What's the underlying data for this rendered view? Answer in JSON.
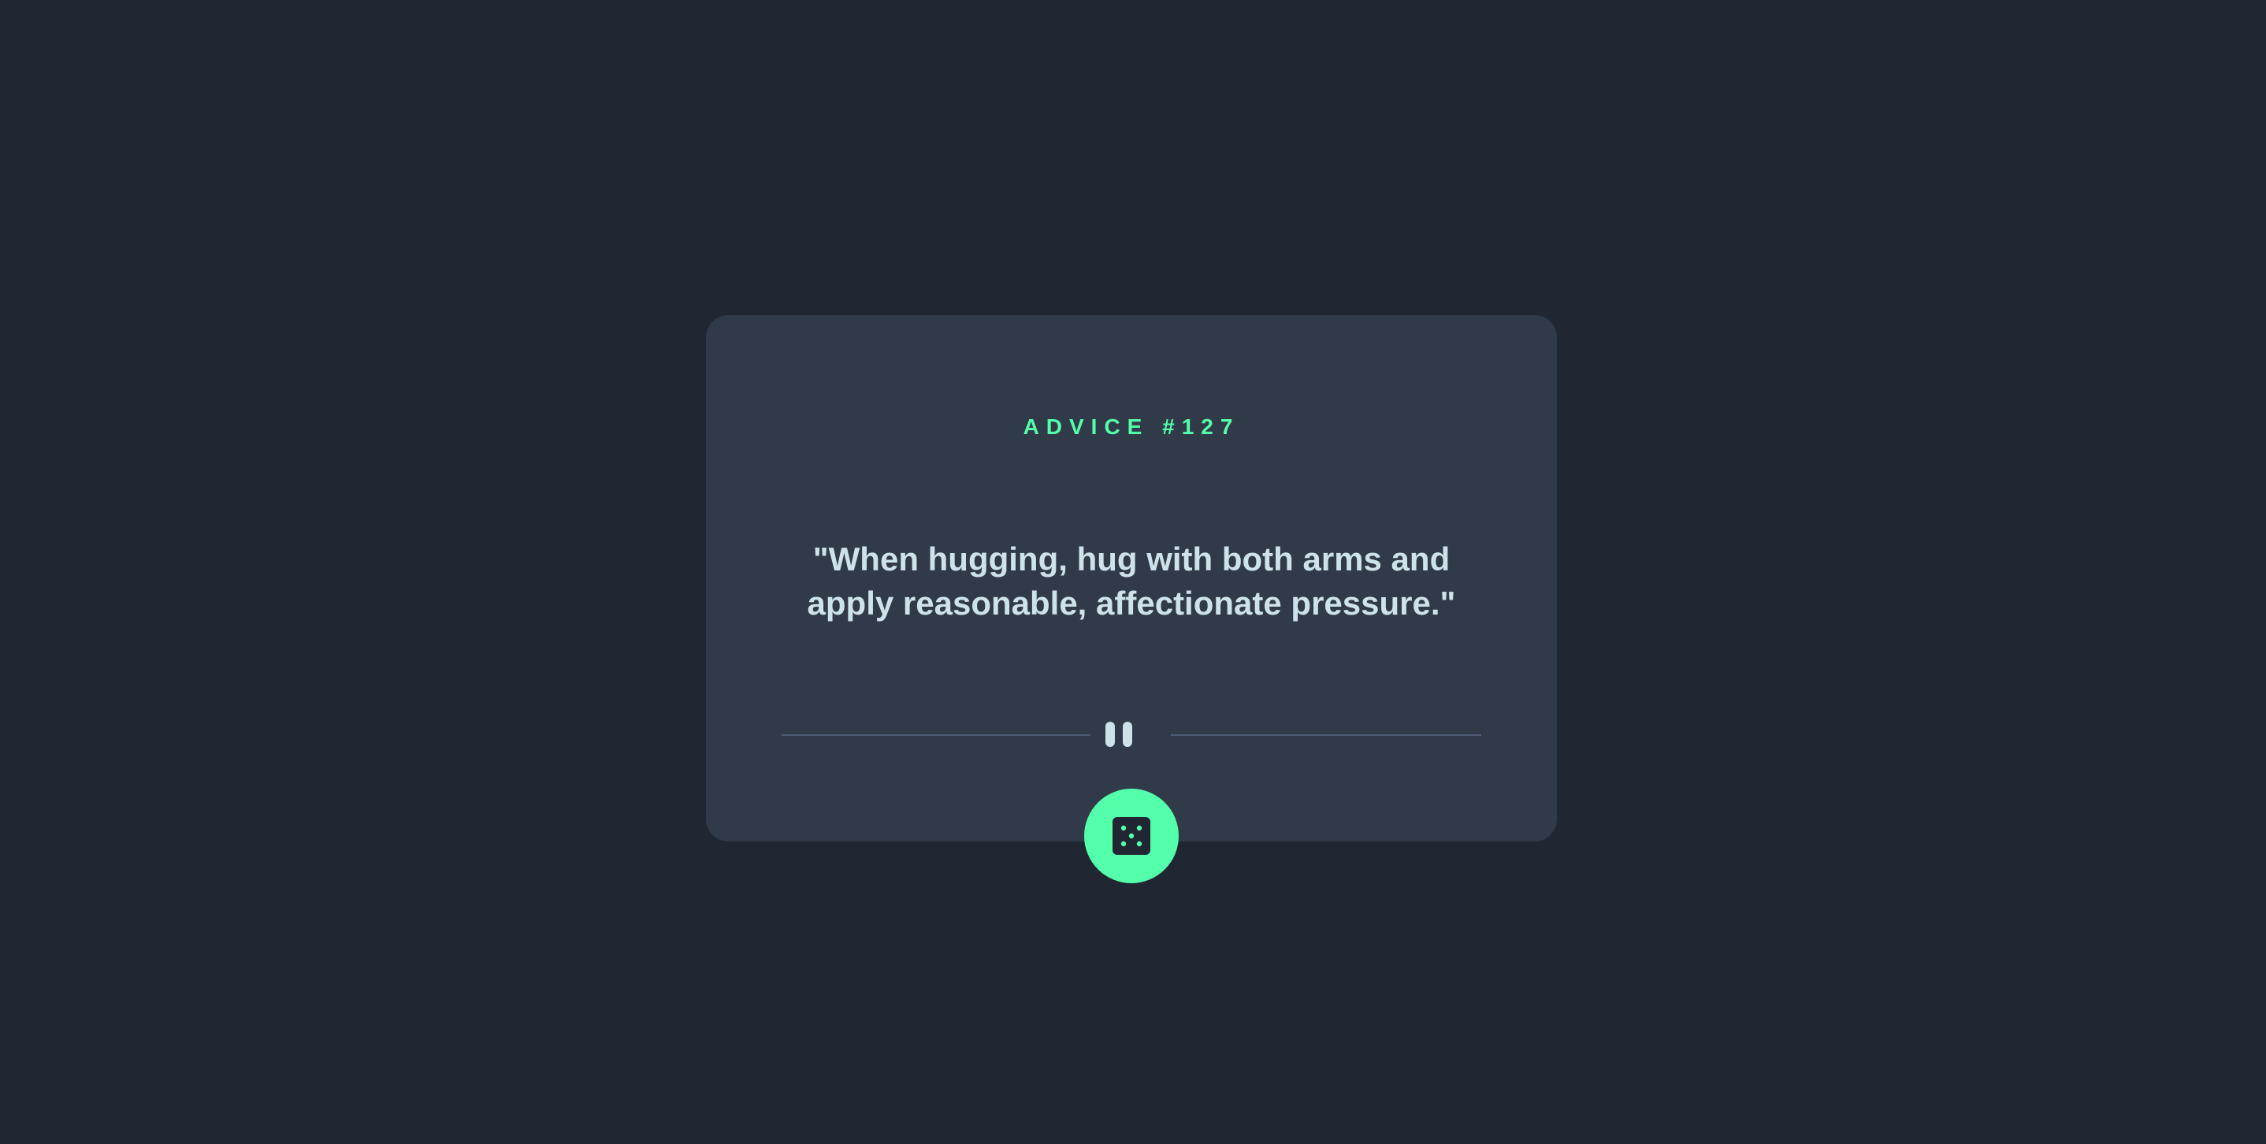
{
  "advice": {
    "id_label": "ADVICE #127",
    "quote": "\"When hugging, hug with both arms and apply reasonable, affectionate pressure.\""
  },
  "icons": {
    "divider": "pause-icon",
    "button": "dice-icon"
  },
  "colors": {
    "page_background": "#202632",
    "card_background": "#313a48",
    "accent": "#53ffaa",
    "quote_text": "#cee3e9",
    "divider_line": "#4f5d74"
  }
}
